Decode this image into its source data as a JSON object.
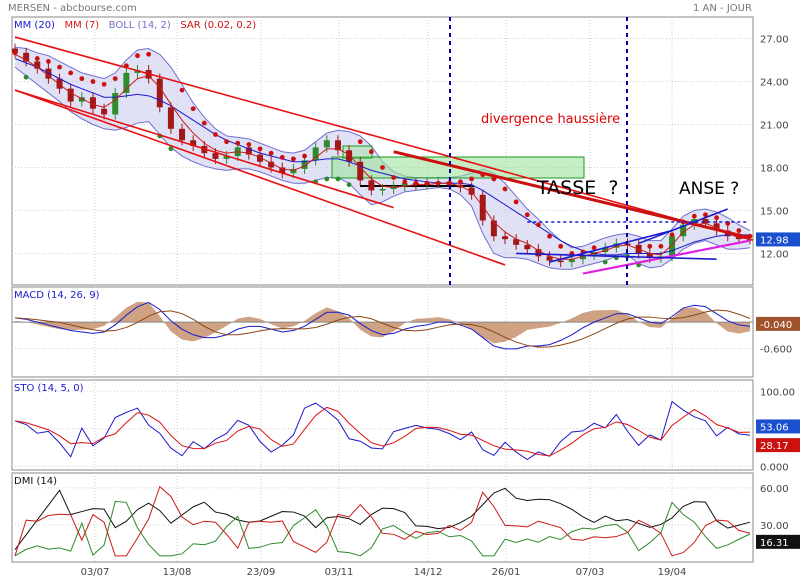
{
  "header": {
    "title": "MERSEN - abcbourse.com",
    "period": "1 AN - JOUR"
  },
  "annotations": {
    "divergence": "divergence haussière",
    "tasse": "TASSE  ?",
    "anse": "ANSE ?"
  },
  "colors": {
    "frame": "#888888",
    "grid": "#cfcfcf",
    "up": "#2e8b2e",
    "down": "#a01818",
    "trend": "#e81010",
    "mm20": "#1a1acc",
    "mm7": "#cc1a1a",
    "boll": "#6f6fd0",
    "bollFill": "#c9c9ef",
    "sarUp": "#2e8b2e",
    "sarDown": "#cc1010",
    "magenta": "#e020e0",
    "macd": "#1a1acc",
    "signal": "#8b4513",
    "histo": "#b97a4f",
    "sto": "#1a1acc",
    "stoSig": "#dd1111",
    "dmi": "#111111",
    "dip": "#2e8b2e",
    "dim": "#cc1a1a"
  },
  "chart_data": [
    {
      "type": "line",
      "panel": "price",
      "legend": [
        "MM (20)",
        "MM (7)",
        "BOLL (14, 2)",
        "SAR (0.02, 0.2)"
      ],
      "x_labels": [
        "03/07",
        "13/08",
        "23/09",
        "03/11",
        "14/12",
        "26/01",
        "07/03",
        "19/04"
      ],
      "y_ticks": [
        12.0,
        15.0,
        18.0,
        21.0,
        24.0,
        27.0
      ],
      "ylim": [
        9.8,
        28.5
      ],
      "last_value": "12.98",
      "closes": [
        26.0,
        25.4,
        24.9,
        24.2,
        23.5,
        22.6,
        22.9,
        22.1,
        21.7,
        23.2,
        24.6,
        24.8,
        24.2,
        22.2,
        20.7,
        19.9,
        19.5,
        19.0,
        18.6,
        18.8,
        19.4,
        18.9,
        18.4,
        18.0,
        17.6,
        17.9,
        18.5,
        19.4,
        19.9,
        19.2,
        18.4,
        17.1,
        16.4,
        16.5,
        16.7,
        16.9,
        16.8,
        16.9,
        17.0,
        16.8,
        16.6,
        16.1,
        14.3,
        13.2,
        13.0,
        12.6,
        12.3,
        11.8,
        11.5,
        11.4,
        11.6,
        11.9,
        12.1,
        12.4,
        12.7,
        12.6,
        12.0,
        11.7,
        11.8,
        13.2,
        14.0,
        14.4,
        14.1,
        13.6,
        13.2,
        13.0,
        12.98
      ],
      "mm20": [
        25.6,
        25.3,
        25.0,
        24.6,
        24.2,
        23.8,
        23.5,
        23.2,
        22.9,
        22.9,
        23.0,
        23.1,
        23.0,
        22.7,
        22.3,
        21.8,
        21.3,
        20.8,
        20.3,
        19.9,
        19.6,
        19.3,
        19.0,
        18.8,
        18.6,
        18.4,
        18.4,
        18.5,
        18.6,
        18.6,
        18.4,
        18.1,
        17.8,
        17.6,
        17.4,
        17.2,
        17.1,
        17.0,
        16.9,
        16.9,
        16.9,
        16.8,
        16.4,
        15.9,
        15.4,
        14.9,
        14.4,
        13.9,
        13.4,
        12.9,
        12.5,
        12.2,
        12.0,
        11.9,
        11.9,
        12.0,
        12.0,
        12.0,
        12.0,
        12.2,
        12.5,
        12.8,
        13.0,
        13.2,
        13.3,
        13.3,
        13.3
      ],
      "mm7": [
        25.9,
        25.5,
        25.0,
        24.4,
        23.8,
        23.2,
        22.8,
        22.4,
        22.2,
        22.7,
        23.5,
        24.2,
        24.4,
        23.6,
        22.4,
        21.3,
        20.4,
        19.7,
        19.2,
        19.0,
        19.1,
        19.0,
        18.7,
        18.3,
        17.9,
        17.8,
        18.1,
        18.7,
        19.3,
        19.3,
        18.9,
        18.0,
        17.2,
        16.7,
        16.6,
        16.7,
        16.8,
        16.8,
        16.9,
        16.9,
        16.7,
        16.3,
        15.3,
        14.2,
        13.5,
        13.0,
        12.7,
        12.2,
        11.8,
        11.6,
        11.6,
        11.8,
        12.0,
        12.2,
        12.5,
        12.6,
        12.3,
        12.0,
        11.9,
        12.6,
        13.5,
        14.0,
        14.1,
        13.8,
        13.4,
        13.1,
        13.0
      ],
      "boll_upper": [
        26.4,
        26.3,
        26.0,
        25.8,
        25.4,
        25.0,
        24.6,
        24.4,
        24.2,
        24.6,
        25.5,
        26.2,
        26.3,
        25.9,
        25.0,
        23.8,
        22.5,
        21.5,
        20.7,
        20.2,
        20.1,
        20.0,
        19.7,
        19.4,
        19.1,
        19.0,
        19.2,
        19.8,
        20.4,
        20.6,
        20.5,
        20.2,
        19.5,
        18.4,
        17.7,
        17.4,
        17.3,
        17.3,
        17.3,
        17.3,
        17.4,
        17.6,
        17.9,
        17.6,
        16.9,
        16.0,
        15.1,
        14.4,
        13.6,
        12.9,
        12.4,
        12.5,
        12.8,
        13.1,
        13.3,
        13.4,
        13.2,
        12.9,
        12.9,
        13.7,
        14.6,
        15.0,
        15.1,
        14.9,
        14.5,
        14.0,
        13.6
      ],
      "boll_lower": [
        25.0,
        24.4,
        23.8,
        23.2,
        22.6,
        21.9,
        21.4,
        21.0,
        20.7,
        20.6,
        20.8,
        21.1,
        21.2,
        20.3,
        19.4,
        18.8,
        18.4,
        18.1,
        17.9,
        17.8,
        17.9,
        17.9,
        17.7,
        17.4,
        17.1,
        16.9,
        16.9,
        17.1,
        17.3,
        17.3,
        16.9,
        16.1,
        15.4,
        15.6,
        16.0,
        16.3,
        16.4,
        16.5,
        16.6,
        16.5,
        16.1,
        15.3,
        13.4,
        12.0,
        11.7,
        11.7,
        11.6,
        11.3,
        11.0,
        10.9,
        10.9,
        11.1,
        11.3,
        11.5,
        11.8,
        11.9,
        11.3,
        11.0,
        11.1,
        11.6,
        12.3,
        12.7,
        12.9,
        12.6,
        12.3,
        12.3,
        12.4
      ],
      "trendlines": [
        {
          "from": [
            0,
            27.1
          ],
          "to": [
            66,
            13.0
          ]
        },
        {
          "from": [
            0,
            23.4
          ],
          "to": [
            34,
            15.2
          ]
        },
        {
          "from": [
            0,
            23.4
          ],
          "to": [
            44,
            11.2
          ]
        },
        {
          "from": [
            34,
            19.1
          ],
          "to": [
            66,
            13.1
          ]
        },
        {
          "from": [
            48,
            11.4
          ],
          "to": [
            59,
            13.6
          ]
        },
        {
          "from": [
            51,
            10.6
          ],
          "to": [
            66,
            12.9
          ]
        },
        {
          "from": [
            56,
            12.7
          ],
          "to": [
            64,
            15.1
          ]
        },
        {
          "from": [
            45,
            12.0
          ],
          "to": [
            63,
            11.6
          ]
        }
      ]
    },
    {
      "type": "line",
      "panel": "macd",
      "legend": "MACD (14, 26, 9)",
      "y_ticks": [
        -0.6
      ],
      "y_tick_labels": [
        "-0.600"
      ],
      "ylim": [
        -1.25,
        0.8
      ],
      "last_value": "-0.040"
    },
    {
      "type": "line",
      "panel": "sto",
      "legend": "STO (14, 5, 0)",
      "y_ticks": [
        0,
        50,
        100
      ],
      "y_tick_labels": [
        "0.000",
        "50.00",
        "100.00"
      ],
      "ylim": [
        -5,
        115
      ],
      "last_values": [
        "53.06",
        "28.17"
      ]
    },
    {
      "type": "line",
      "panel": "dmi",
      "legend": "DMI (14)",
      "y_ticks": [
        30,
        60
      ],
      "y_tick_labels": [
        "30.00",
        "60.00"
      ],
      "ylim": [
        0,
        72
      ],
      "last_value": "16.31"
    }
  ]
}
